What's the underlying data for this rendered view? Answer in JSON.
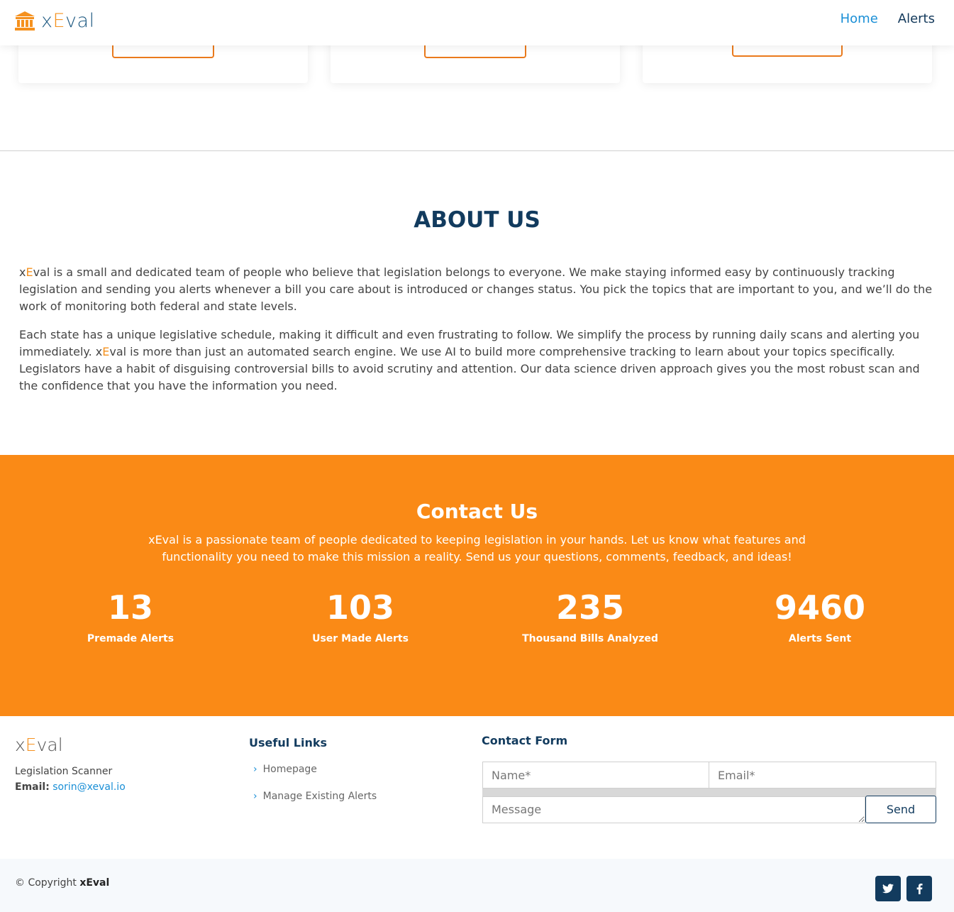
{
  "header": {
    "logo_prefix": "x",
    "logo_accent": "E",
    "logo_suffix": "val",
    "nav": [
      {
        "label": "Home"
      },
      {
        "label": "Alerts"
      }
    ]
  },
  "about": {
    "title": "ABOUT US",
    "p1_brand_prefix": "x",
    "p1_brand_accent": "E",
    "p1_brand_suffix": "val",
    "p1_text": " is a small and dedicated team of people who believe that legislation belongs to everyone. We make staying informed easy by continuously tracking legislation and sending you alerts whenever a bill you care about is introduced or changes status. You pick the topics that are important to you, and we’ll do the work of monitoring both federal and state levels.",
    "p2_text_a": "Each state has a unique legislative schedule, making it difficult and even frustrating to follow. We simplify the process by running daily scans and alerting you immediately. ",
    "p2_brand_prefix": "x",
    "p2_brand_accent": "E",
    "p2_brand_suffix": "val",
    "p2_text_b": " is more than just an automated search engine. We use AI to build more comprehensive tracking to learn about your topics specifically. Legislators have a habit of disguising controversial bills to avoid scrutiny and attention. Our data science driven approach gives you the most robust scan and the confidence that you have the information you need."
  },
  "contact": {
    "title": "Contact Us",
    "description": "xEval is a passionate team of people dedicated to keeping legislation in your hands. Let us know what features and functionality you need to make this mission a reality. Send us your questions, comments, feedback, and ideas!",
    "stats": [
      {
        "value": "13",
        "label": "Premade Alerts"
      },
      {
        "value": "103",
        "label": "User Made Alerts"
      },
      {
        "value": "235",
        "label": "Thousand Bills Analyzed"
      },
      {
        "value": "9460",
        "label": "Alerts Sent"
      }
    ]
  },
  "footer": {
    "brand_prefix": "x",
    "brand_accent": "E",
    "brand_suffix": "val",
    "tagline": "Legislation Scanner",
    "email_label": "Email:",
    "email": "sorin@xeval.io",
    "links_title": "Useful Links",
    "links": [
      {
        "label": "Homepage"
      },
      {
        "label": "Manage Existing Alerts"
      }
    ],
    "form_title": "Contact Form",
    "name_placeholder": "Name*",
    "email_placeholder": "Email*",
    "message_placeholder": "Message",
    "send_label": "Send",
    "copyright_prefix": "© Copyright",
    "copyright_brand": "xEval"
  },
  "colors": {
    "accent": "#fa8a16",
    "navy": "#123b5e",
    "link_blue": "#1a8fd6"
  },
  "icons": {
    "logo": "bank-icon",
    "link_chevron": "chevron-right-icon",
    "social": [
      "twitter-icon",
      "facebook-icon"
    ]
  }
}
